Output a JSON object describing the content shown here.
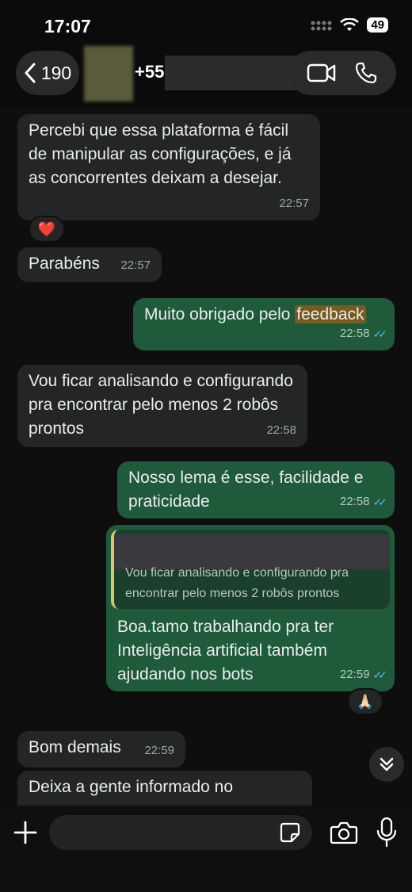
{
  "status_bar": {
    "time": "17:07",
    "battery": "49"
  },
  "header": {
    "back_count": "190",
    "contact_name": "+55 8"
  },
  "messages": [
    {
      "dir": "in",
      "text": "Percebi que essa plataforma é fácil de manipular as configurações, e já as concorrentes deixam a desejar.",
      "time": "22:57",
      "reaction": "❤️"
    },
    {
      "dir": "in",
      "text": "Parabéns",
      "time": "22:57"
    },
    {
      "dir": "out",
      "text_before": "Muito obrigado pelo ",
      "highlight": "feedback",
      "time": "22:58",
      "ticks": "✓✓"
    },
    {
      "dir": "in",
      "text": "Vou ficar analisando e configurando  pra encontrar pelo menos 2 robôs prontos",
      "time": "22:58"
    },
    {
      "dir": "out",
      "text": "Nosso lema é esse, facilidade e praticidade",
      "time": "22:58",
      "ticks": "✓✓"
    },
    {
      "dir": "out",
      "quote": "Vou ficar analisando e configurando  pra encontrar pelo menos 2 robôs prontos",
      "text": "Boa.tamo trabalhando pra ter Inteligência artificial  também ajudando nos bots",
      "time": "22:59",
      "ticks": "✓✓",
      "reaction": "🙏🏻"
    },
    {
      "dir": "in",
      "text": "Bom demais",
      "time": "22:59"
    },
    {
      "dir": "in",
      "text": "Deixa a gente informado no"
    }
  ],
  "composer": {
    "placeholder": ""
  },
  "icons": {
    "back": "chevron-left-icon",
    "video": "video-camera-icon",
    "phone": "phone-icon",
    "scroll": "double-chevron-down-icon",
    "plus": "plus-icon",
    "sticker": "sticker-icon",
    "camera": "camera-icon",
    "mic": "microphone-icon"
  },
  "colors": {
    "incoming_bubble": "#242626",
    "outgoing_bubble": "#1f5a3a",
    "read_ticks": "#53bdeb",
    "highlight": "#7a5a1e"
  }
}
